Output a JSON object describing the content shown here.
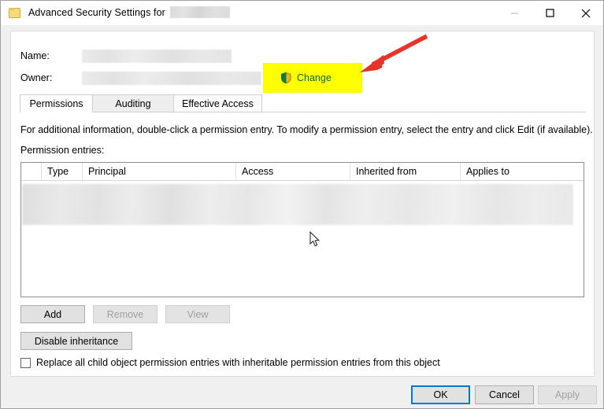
{
  "window": {
    "title_prefix": "Advanced Security Settings for",
    "title_redacted": "",
    "icon": "folder-icon",
    "controls": {
      "minimize": "minimize-icon",
      "maximize": "maximize-icon",
      "close": "close-icon"
    }
  },
  "fields": {
    "name_label": "Name:",
    "name_value": "",
    "owner_label": "Owner:",
    "owner_value": "",
    "change_label": "Change",
    "change_icon": "uac-shield-icon",
    "highlight_color": "#ffff00",
    "change_link_color": "#0a6b2e"
  },
  "tabs": [
    {
      "label": "Permissions",
      "active": true
    },
    {
      "label": "Auditing",
      "active": false
    },
    {
      "label": "Effective Access",
      "active": false
    }
  ],
  "main": {
    "info_text": "For additional information, double-click a permission entry. To modify a permission entry, select the entry and click Edit (if available).",
    "entries_label": "Permission entries:",
    "columns": [
      "",
      "Type",
      "Principal",
      "Access",
      "Inherited from",
      "Applies to"
    ],
    "rows": [
      {
        "type": "",
        "principal": "",
        "access": "",
        "inherited_from": "",
        "applies_to": "",
        "redacted": true
      }
    ]
  },
  "buttons": {
    "add": {
      "label": "Add",
      "enabled": true
    },
    "remove": {
      "label": "Remove",
      "enabled": false
    },
    "view": {
      "label": "View",
      "enabled": false
    },
    "disable_inheritance": {
      "label": "Disable inheritance",
      "enabled": true
    }
  },
  "checkbox": {
    "label": "Replace all child object permission entries with inheritable permission entries from this object",
    "checked": false
  },
  "footer": {
    "ok": {
      "label": "OK",
      "enabled": true,
      "default": true
    },
    "cancel": {
      "label": "Cancel",
      "enabled": true
    },
    "apply": {
      "label": "Apply",
      "enabled": false
    }
  },
  "annotations": {
    "arrow": {
      "color": "#e8332a",
      "points_to": "change-link"
    },
    "cursor": "arrow-pointer"
  }
}
